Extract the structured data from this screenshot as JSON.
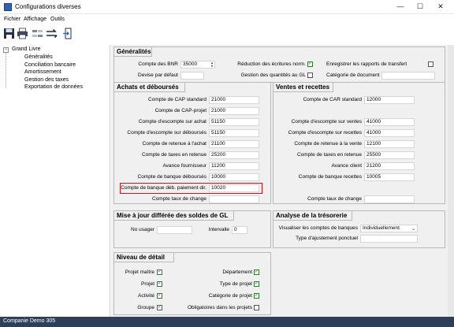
{
  "window": {
    "title": "Configurations diverses",
    "minimize": "—",
    "maximize": "☐",
    "close": "✕"
  },
  "menu": {
    "file": "Fichier",
    "view": "Affichage",
    "tools": "Outils"
  },
  "tree": {
    "root": "Grand Livre",
    "items": [
      "Généralités",
      "Conciliation bancaire",
      "Amortissement",
      "Gestion des taxes",
      "Exportation de données"
    ]
  },
  "general": {
    "title": "Généralités",
    "bnr_label": "Compte des BNR",
    "bnr_value": "35000",
    "default_currency_label": "Devise par défaut",
    "default_currency_value": "",
    "reduction_label": "Réduction des écritures norm.",
    "reduction_checked": true,
    "qty_label": "Gestion des quantités au GL",
    "qty_checked": false,
    "save_reports_label": "Enregistrer les rapports de transfert",
    "save_reports_checked": false,
    "doc_category_label": "Catégorie de document",
    "doc_category_value": ""
  },
  "purchases": {
    "title": "Achats et déboursés",
    "rows": [
      {
        "label": "Compte de CAP standard",
        "value": "21000"
      },
      {
        "label": "Compte de CAP-projet",
        "value": "21000"
      },
      {
        "label": "Compte d'escompte sur achat",
        "value": "51150"
      },
      {
        "label": "Compte d'escompte sur déboursés",
        "value": "51150"
      },
      {
        "label": "Compte de retenue à l'achat",
        "value": "21100"
      },
      {
        "label": "Compte de taxes en retenue",
        "value": "25200"
      },
      {
        "label": "Avance fournisseur",
        "value": "11200"
      },
      {
        "label": "Compte de banque déboursés",
        "value": "10000"
      },
      {
        "label": "Compte de banque déb. paiement dir.",
        "value": "10020"
      },
      {
        "label": "Compte taux de change",
        "value": ""
      }
    ]
  },
  "sales": {
    "title": "Ventes et recettes",
    "car_label": "Compte de CAR standard",
    "car_value": "12000",
    "rows": [
      {
        "label": "Compte d'escompte sur ventes",
        "value": "41000"
      },
      {
        "label": "Compte d'escompte sur recettes",
        "value": "41000"
      },
      {
        "label": "Compte de retenue à la vente",
        "value": "12100"
      },
      {
        "label": "Compte de taxes en retenue",
        "value": "25500"
      },
      {
        "label": "Avance client",
        "value": "21200"
      },
      {
        "label": "Compte de banque recettes",
        "value": "10005"
      }
    ],
    "fx_label": "Compte taux de change",
    "fx_value": ""
  },
  "deferred": {
    "title": "Mise à jour différée des soldes de GL",
    "user_label": "No usager",
    "user_value": "",
    "interval_label": "Intervalle",
    "interval_value": "0"
  },
  "treasury": {
    "title": "Analyse de la trésorerie",
    "view_label": "Visualiser les comptes de banques",
    "view_value": "Individuellement",
    "adjust_label": "Type d'ajustement ponctuel",
    "adjust_value": ""
  },
  "detail": {
    "title": "Niveau de détail",
    "left": [
      {
        "label": "Projet maître",
        "checked": true
      },
      {
        "label": "Projet",
        "checked": true
      },
      {
        "label": "Activité",
        "checked": true
      },
      {
        "label": "Groupe",
        "checked": true
      }
    ],
    "right": [
      {
        "label": "Département",
        "checked": true
      },
      {
        "label": "Type de projet",
        "checked": true
      },
      {
        "label": "Catégorie de projet",
        "checked": true
      },
      {
        "label": "Obligatoires dans les projets",
        "checked": false
      }
    ]
  },
  "status": {
    "company": "Companie Demo 305"
  },
  "colors": {
    "statusbar": "#2e3f57",
    "highlight": "#d0121b",
    "check": "#2e7d32"
  },
  "icons": [
    "save-icon",
    "print-icon",
    "transfer-icon",
    "swap-icon",
    "export-icon"
  ]
}
